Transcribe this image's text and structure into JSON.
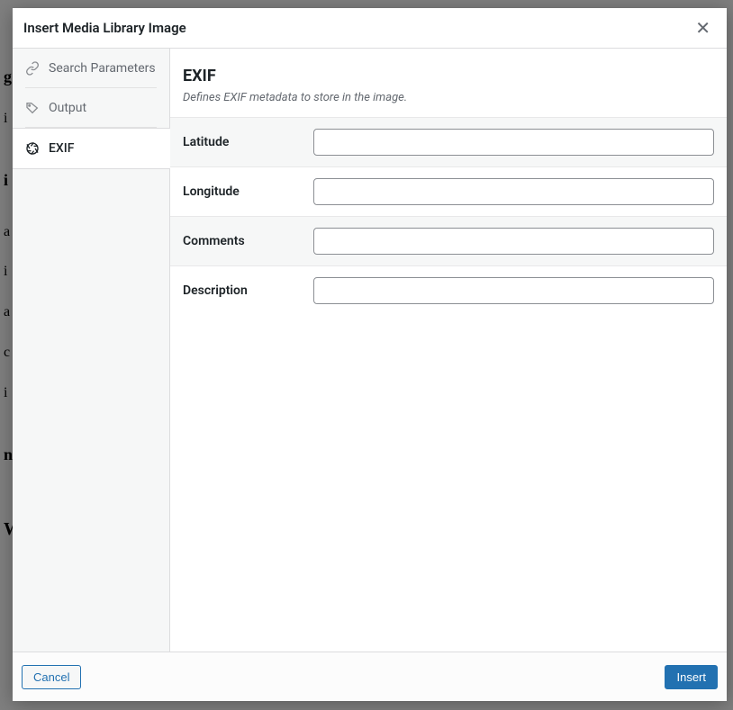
{
  "modal": {
    "title": "Insert Media Library Image"
  },
  "sidebar": {
    "items": [
      {
        "label": "Search Parameters"
      },
      {
        "label": "Output"
      },
      {
        "label": "EXIF"
      }
    ]
  },
  "content": {
    "title": "EXIF",
    "description": "Defines EXIF metadata to store in the image.",
    "fields": [
      {
        "label": "Latitude",
        "value": ""
      },
      {
        "label": "Longitude",
        "value": ""
      },
      {
        "label": "Comments",
        "value": ""
      },
      {
        "label": "Description",
        "value": ""
      }
    ]
  },
  "footer": {
    "cancel": "Cancel",
    "insert": "Insert"
  }
}
